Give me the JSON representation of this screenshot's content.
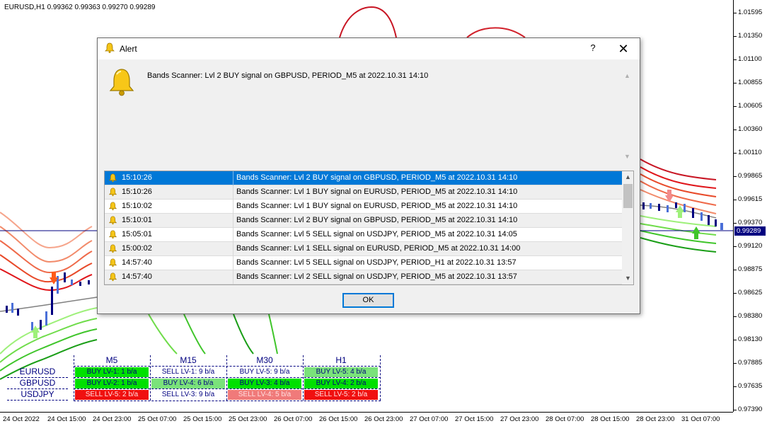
{
  "chart": {
    "title": "EURUSD,H1  0.99362 0.99363 0.99270 0.99289",
    "current_price": "0.99289",
    "price_labels": [
      "1.01595",
      "1.01350",
      "1.01100",
      "1.00855",
      "1.00605",
      "1.00360",
      "1.00110",
      "0.99865",
      "0.99615",
      "0.99370",
      "0.99120",
      "0.98875",
      "0.98625",
      "0.98380",
      "0.98130",
      "0.97885",
      "0.97635",
      "0.97390"
    ],
    "time_labels": [
      "24 Oct 2022",
      "24 Oct 15:00",
      "24 Oct 23:00",
      "25 Oct 07:00",
      "25 Oct 15:00",
      "25 Oct 23:00",
      "26 Oct 07:00",
      "26 Oct 15:00",
      "26 Oct 23:00",
      "27 Oct 07:00",
      "27 Oct 15:00",
      "27 Oct 23:00",
      "28 Oct 07:00",
      "28 Oct 15:00",
      "28 Oct 23:00",
      "31 Oct 07:00"
    ],
    "colors": {
      "upper_band": "#e0161b",
      "lower_band": "#1a9e17",
      "price_line": "#000080",
      "current_price_bg": "#000080"
    }
  },
  "scanner": {
    "timeframes": [
      "M5",
      "M15",
      "M30",
      "H1"
    ],
    "symbols": [
      "EURUSD",
      "GBPUSD",
      "USDJPY"
    ],
    "cells": [
      [
        {
          "text": "BUY LV-1: 1 b/a",
          "bg": "#00e000"
        },
        {
          "text": "SELL LV-1: 9 b/a",
          "bg": "#ffffff"
        },
        {
          "text": "BUY LV-5: 9 b/a",
          "bg": "#ffffff"
        },
        {
          "text": "BUY LV-5: 4 b/a",
          "bg": "#7ae27a"
        }
      ],
      [
        {
          "text": "BUY LV-2: 1 b/a",
          "bg": "#00e000"
        },
        {
          "text": "BUY LV-4: 6 b/a",
          "bg": "#7ae27a"
        },
        {
          "text": "BUY LV-3: 4 b/a",
          "bg": "#00e000"
        },
        {
          "text": "BUY LV-4: 2 b/a",
          "bg": "#00e000"
        }
      ],
      [
        {
          "text": "SELL LV-5: 2 b/a",
          "bg": "#f01010"
        },
        {
          "text": "SELL LV-3: 9 b/a",
          "bg": "#ffffff"
        },
        {
          "text": "SELL LV-4: 5 b/a",
          "bg": "#f07a7a"
        },
        {
          "text": "SELL LV-5: 2 b/a",
          "bg": "#f01010"
        }
      ]
    ]
  },
  "dialog": {
    "title": "Alert",
    "help_label": "?",
    "close_label": "✕",
    "message": "Bands Scanner: Lvl 2 BUY signal on GBPUSD, PERIOD_M5 at 2022.10.31 14:10",
    "ok_label": "OK",
    "alerts": [
      {
        "time": "15:10:26",
        "message": "Bands Scanner: Lvl 2 BUY signal on GBPUSD, PERIOD_M5 at 2022.10.31 14:10",
        "selected": true
      },
      {
        "time": "15:10:26",
        "message": "Bands Scanner: Lvl 1 BUY signal on EURUSD, PERIOD_M5 at 2022.10.31 14:10",
        "selected": false
      },
      {
        "time": "15:10:02",
        "message": "Bands Scanner: Lvl 1 BUY signal on EURUSD, PERIOD_M5 at 2022.10.31 14:10",
        "selected": false
      },
      {
        "time": "15:10:01",
        "message": "Bands Scanner: Lvl 2 BUY signal on GBPUSD, PERIOD_M5 at 2022.10.31 14:10",
        "selected": false
      },
      {
        "time": "15:05:01",
        "message": "Bands Scanner: Lvl 5 SELL signal on USDJPY, PERIOD_M5 at 2022.10.31 14:05",
        "selected": false
      },
      {
        "time": "15:00:02",
        "message": "Bands Scanner: Lvl 1 SELL signal on EURUSD, PERIOD_M5 at 2022.10.31 14:00",
        "selected": false
      },
      {
        "time": "14:57:40",
        "message": "Bands Scanner: Lvl 5 SELL signal on USDJPY, PERIOD_H1 at 2022.10.31 13:57",
        "selected": false
      },
      {
        "time": "14:57:40",
        "message": "Bands Scanner: Lvl 2 SELL signal on USDJPY, PERIOD_M5 at 2022.10.31 13:57",
        "selected": false
      }
    ]
  }
}
